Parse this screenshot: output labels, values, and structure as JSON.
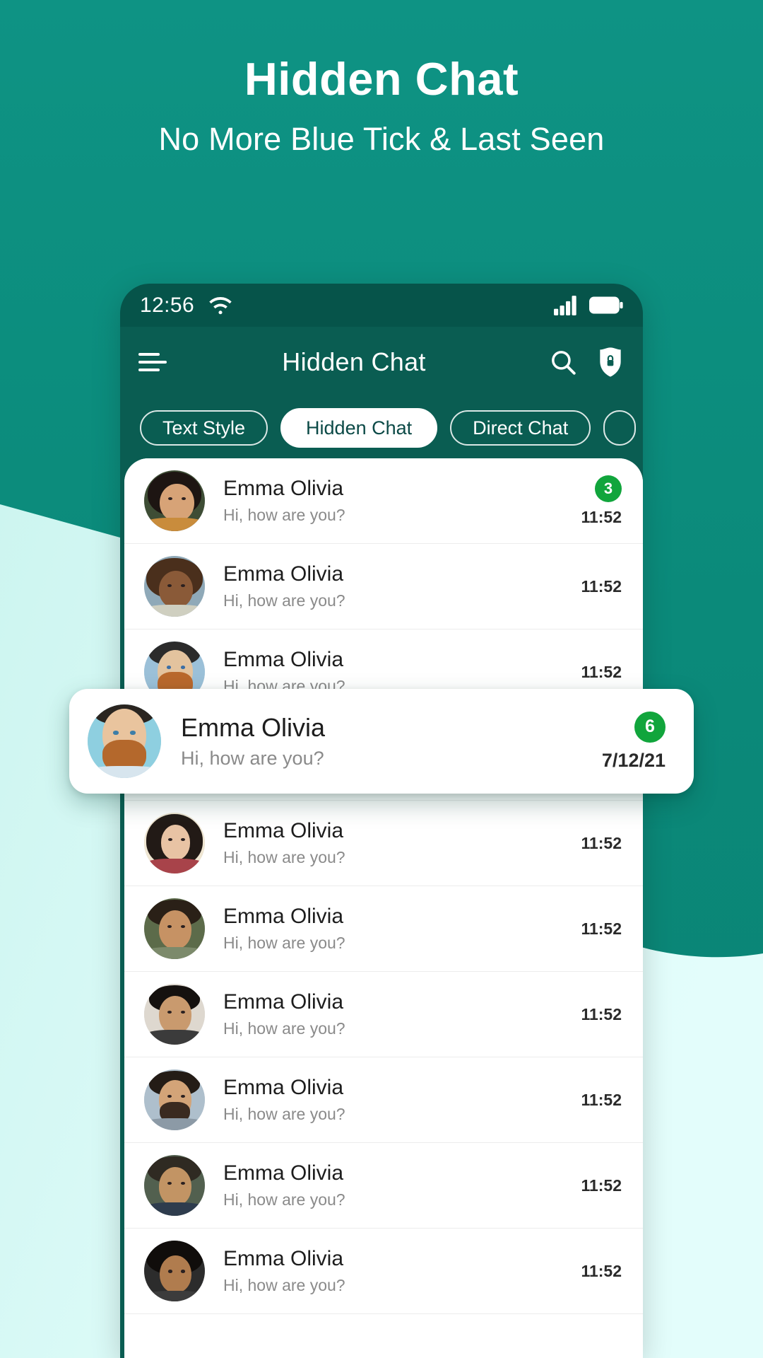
{
  "promo": {
    "title": "Hidden Chat",
    "subtitle": "No More Blue Tick & Last Seen"
  },
  "colors": {
    "brand_teal": "#0c8e7e",
    "appbar_teal": "#0a5d52",
    "statusbar_teal": "#06544a",
    "mint": "#dafcf9",
    "badge_green": "#11a53c",
    "card_white": "#ffffff"
  },
  "phone": {
    "status_bar": {
      "time": "12:56",
      "wifi_icon": "wifi-icon",
      "signal_icon": "cellular-signal-icon",
      "battery_icon": "battery-full-icon"
    },
    "app_bar": {
      "menu_icon": "hamburger-menu-icon",
      "title": "Hidden Chat",
      "search_icon": "search-icon",
      "lock_icon": "shield-lock-icon"
    },
    "tabs": [
      {
        "label": "Text Style",
        "active": false
      },
      {
        "label": "Hidden Chat",
        "active": true
      },
      {
        "label": "Direct Chat",
        "active": false
      },
      {
        "label": "",
        "active": false,
        "partial": true
      }
    ],
    "chat_list": [
      {
        "name": "Emma Olivia",
        "message": "Hi, how are you?",
        "time": "11:52",
        "badge": "3"
      },
      {
        "name": "Emma Olivia",
        "message": "Hi, how are you?",
        "time": "11:52",
        "badge": ""
      },
      {
        "name": "Emma Olivia",
        "message": "Hi, how are you?",
        "time": "11:52",
        "badge": ""
      },
      {
        "name": "Emma Olivia",
        "message": "Hi, how are you?",
        "time": "11:52",
        "badge": ""
      },
      {
        "name": "Emma Olivia",
        "message": "Hi, how are you?",
        "time": "11:52",
        "badge": ""
      },
      {
        "name": "Emma Olivia",
        "message": "Hi, how are you?",
        "time": "11:52",
        "badge": ""
      },
      {
        "name": "Emma Olivia",
        "message": "Hi, how are you?",
        "time": "11:52",
        "badge": ""
      },
      {
        "name": "Emma Olivia",
        "message": "Hi, how are you?",
        "time": "11:52",
        "badge": ""
      },
      {
        "name": "Emma Olivia",
        "message": "Hi, how are you?",
        "time": "11:52",
        "badge": ""
      },
      {
        "name": "Emma Olivia",
        "message": "Hi, how are you?",
        "time": "11:52",
        "badge": ""
      }
    ],
    "highlight_card": {
      "name": "Emma Olivia",
      "message": "Hi, how are you?",
      "time": "7/12/21",
      "badge": "6",
      "avatar_icon": "avatar-bearded-man"
    }
  }
}
